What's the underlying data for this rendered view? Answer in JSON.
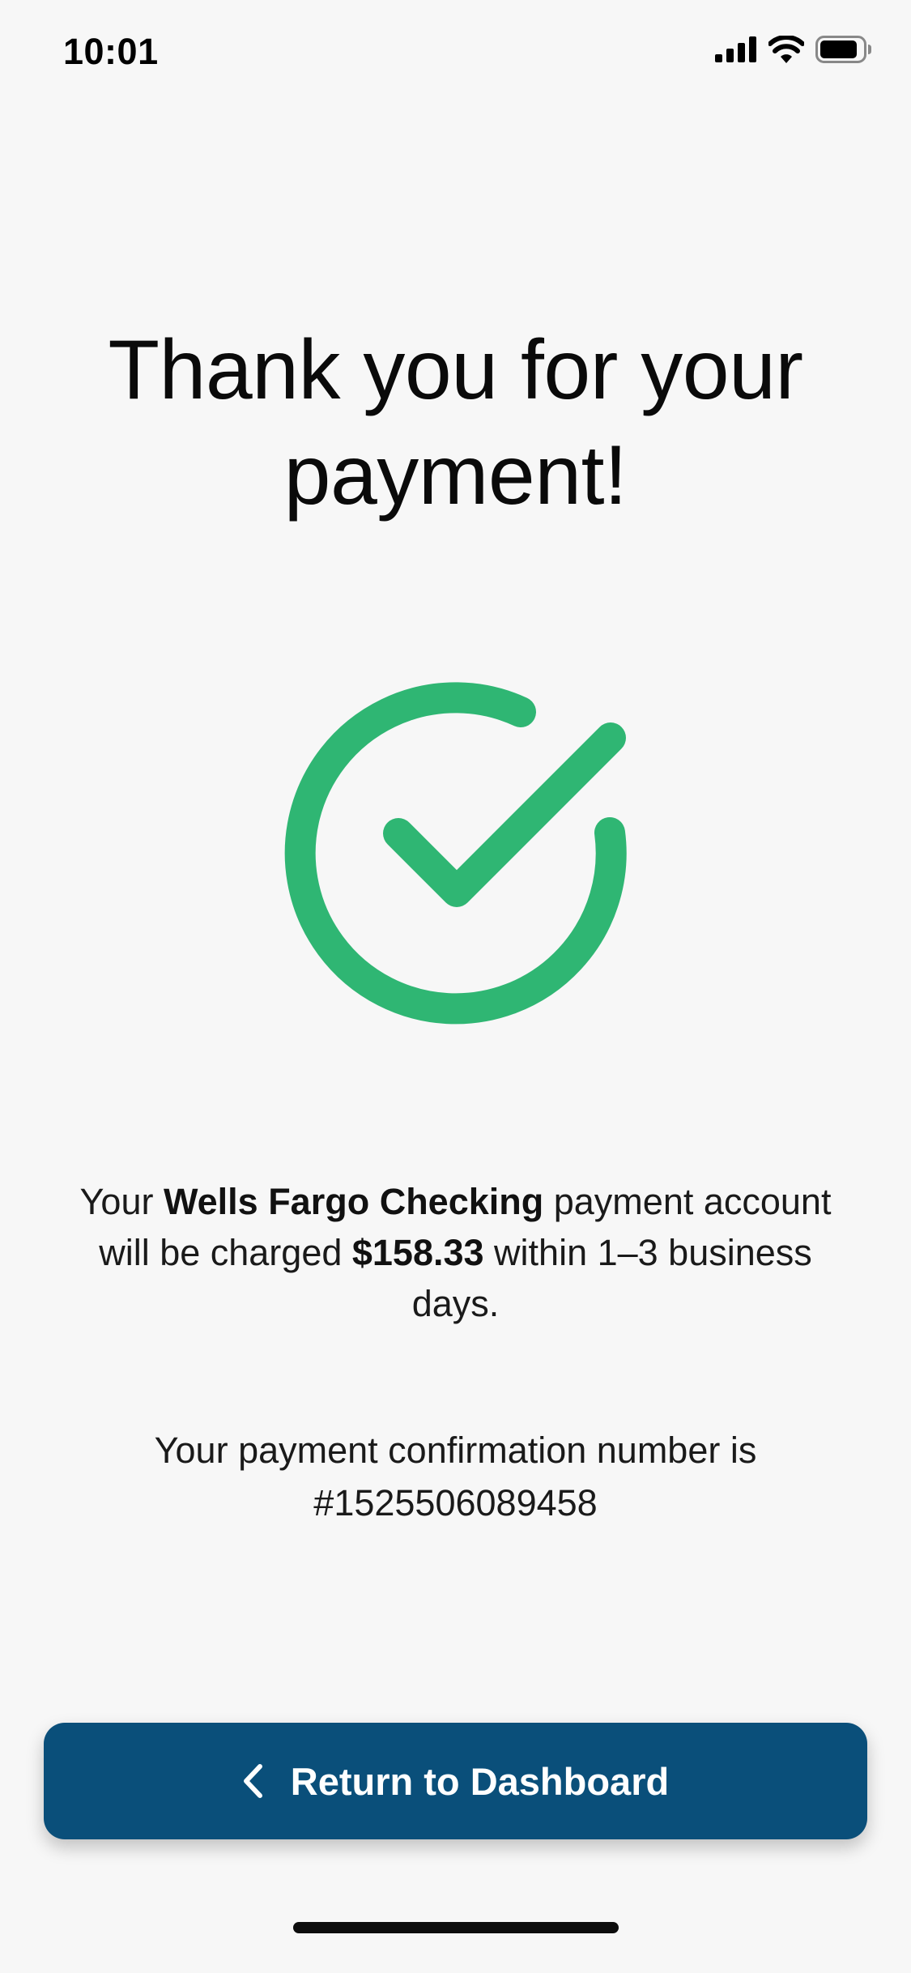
{
  "status_bar": {
    "time": "10:01",
    "icons": [
      "signal-icon",
      "wifi-icon",
      "battery-icon"
    ]
  },
  "title": "Thank you for your payment!",
  "success_icon": {
    "name": "check-circle-icon",
    "color": "#2fb673"
  },
  "message": {
    "prefix": "Your ",
    "account": "Wells Fargo Checking",
    "middle": " payment account will be charged ",
    "amount": "$158.33",
    "suffix": " within 1–3 business days."
  },
  "confirmation": {
    "text": "Your payment confirmation number is",
    "number": "#1525506089458"
  },
  "button": {
    "label": "Return to Dashboard",
    "icon": "chevron-left-icon",
    "background": "#0a4f7a"
  }
}
